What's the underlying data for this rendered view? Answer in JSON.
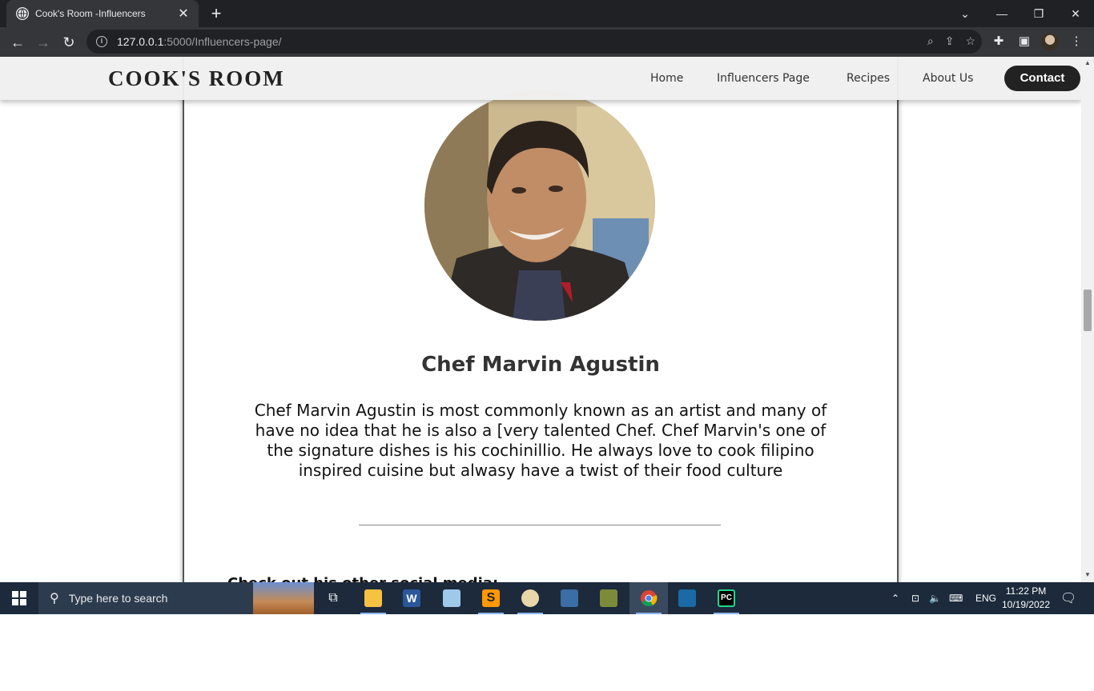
{
  "browser": {
    "tab_title": "Cook's Room -Influencers",
    "url_host": "127.0.0.1",
    "url_rest": ":5000/Influencers-page/"
  },
  "site": {
    "brand": "COOK'S ROOM",
    "nav": [
      "Home",
      "Influencers Page",
      "Recipes",
      "About Us"
    ],
    "contact": "Contact"
  },
  "influencer": {
    "name": "Chef Marvin Agustin",
    "bio": "Chef Marvin Agustin is most commonly known as an artist and many of have no idea that he is also a [very talented Chef. Chef Marvin's one of the signature dishes is his cochinillio. He always love to cook filipino inspired cuisine but alwasy have a twist of their food culture",
    "social_heading": "Check out his other social media:"
  },
  "taskbar": {
    "search_placeholder": "Type here to search",
    "language": "ENG",
    "time": "11:22 PM",
    "date": "10/19/2022"
  },
  "icons": {
    "word": "#2b579a",
    "sublime": "#ff9800",
    "pycharm": "#21d789",
    "explorer": "#f5c242"
  }
}
